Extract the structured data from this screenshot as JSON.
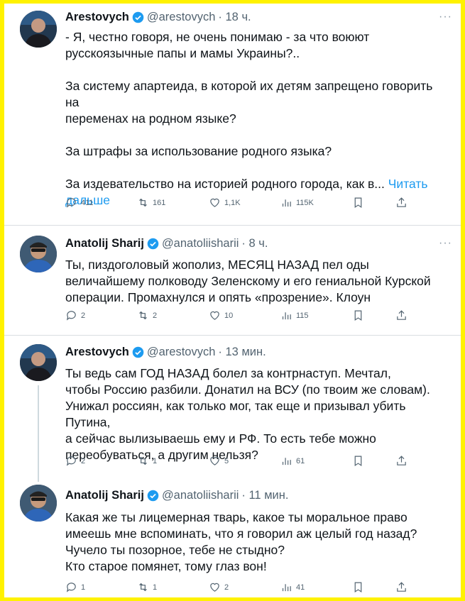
{
  "tweets": [
    {
      "name": "Arestovych",
      "handle": "@arestovych",
      "time": "· 18 ч.",
      "text": "- Я, честно говоря, не очень понимаю - за что воюют\nрусскоязычные папы и мамы Украины?..\n\nЗа систему апартеида, в которой их детям запрещено говорить на\nпеременах на родном языке?\n\nЗа штрафы за использование родного языка?\n\nЗа издевательство на историей родного города, как в... ",
      "read_more": "Читать\nдальше",
      "replies": "411",
      "retweets": "161",
      "likes": "1,1K",
      "views": "115K"
    },
    {
      "name": "Anatolij Sharij",
      "handle": "@anatoliisharii",
      "time": "· 8 ч.",
      "text": "Ты, пиздоголовый жополиз, МЕСЯЦ НАЗАД пел оды\nвеличайшему полководу Зеленскому и его гениальной Курской\nоперации. Промахнулся и опять «прозрение». Клоун",
      "replies": "2",
      "retweets": "2",
      "likes": "10",
      "views": "115"
    },
    {
      "name": "Arestovych",
      "handle": "@arestovych",
      "time": "· 13 мин.",
      "text": "Ты ведь сам ГОД НАЗАД болел за контрнаступ. Мечтал,\nчтобы Россию разбили. Донатил на ВСУ (по твоим же словам).\nУнижал россиян, как только мог, так еще и призывал убить Путина,\nа сейчас вылизываешь ему и РФ. То есть тебе можно\nпереобуваться, а другим нельзя?",
      "replies": "2",
      "retweets": "1",
      "likes": "5",
      "views": "61"
    },
    {
      "name": "Anatolij Sharij",
      "handle": "@anatoliisharii",
      "time": "· 11 мин.",
      "text": "Какая же ты лицемерная тварь, какое ты моральное право\nимеешь мне вспоминать, что я говорил аж целый год назад?\nЧучело ты позорное, тебе не стыдно?\nКто старое помянет, тому глаз вон!",
      "replies": "1",
      "retweets": "1",
      "likes": "2",
      "views": "41"
    }
  ],
  "more_label": "···",
  "colors": {
    "background": "#fff200",
    "accent": "#1d9bf0",
    "muted": "#536471"
  }
}
